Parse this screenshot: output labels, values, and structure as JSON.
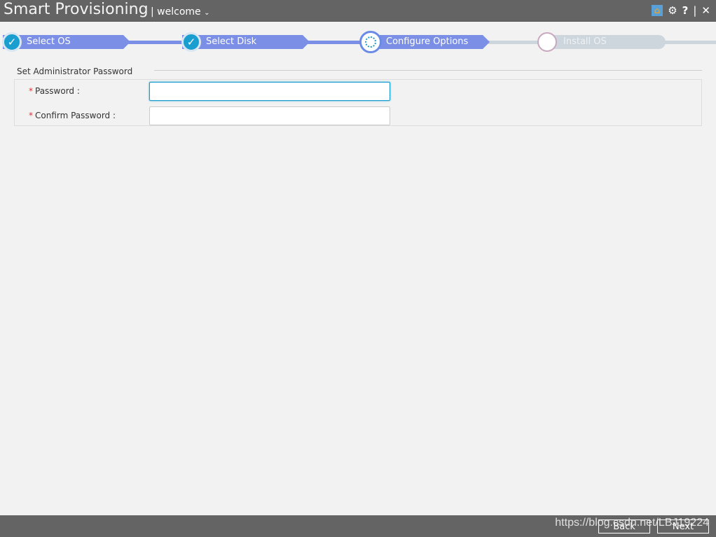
{
  "header": {
    "title": "Smart Provisioning",
    "user": "| welcome",
    "icons": [
      "home-icon",
      "gear-icon",
      "help-icon",
      "close-icon"
    ]
  },
  "steps": [
    {
      "label": "Select OS",
      "state": "done"
    },
    {
      "label": "Select Disk",
      "state": "done"
    },
    {
      "label": "Configure Options",
      "state": "current"
    },
    {
      "label": "Install OS",
      "state": "pending"
    }
  ],
  "colors": {
    "accent": "#7b8fe6",
    "check": "#1a9ed0",
    "pending": "#cdd6dc"
  },
  "form": {
    "section_title": "Set Administrator Password",
    "required_mark": "*",
    "password_label": "Password :",
    "confirm_label": "Confirm Password :",
    "password_value": "",
    "confirm_value": ""
  },
  "footer": {
    "back": "Back",
    "next": "Next",
    "watermark": "https://blog.csdn.net/LBJ19224"
  }
}
